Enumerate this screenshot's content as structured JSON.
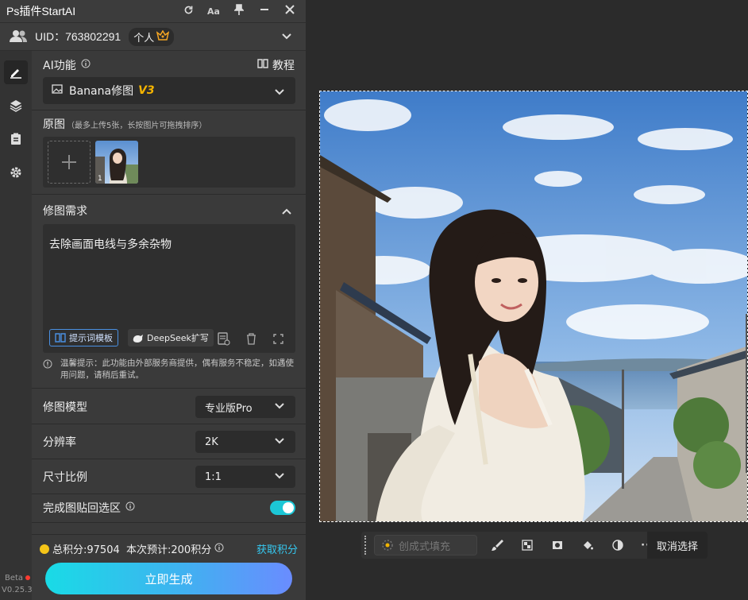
{
  "app": {
    "title": "Ps插件StartAI",
    "title_icons": [
      "refresh-icon",
      "font-size-icon",
      "pin-icon",
      "minimize-icon",
      "close-icon"
    ]
  },
  "user": {
    "uid_label": "UID：763802291",
    "plan_badge": "个人"
  },
  "sidebar": {
    "items": [
      "edit-icon",
      "layers-icon",
      "clipboard-icon",
      "gear-icon"
    ],
    "beta_label": "Beta",
    "version": "V0.25.3"
  },
  "ai_function": {
    "label": "AI功能",
    "tutorial_label": "教程",
    "selected_model": "Banana修图",
    "selected_version": "V3"
  },
  "source_images": {
    "label": "原图",
    "hint": "（最多上传5张，长按图片可拖拽排序）",
    "thumb_index": "1"
  },
  "requirement": {
    "label": "修图需求",
    "prompt_text": "去除画面电线与多余杂物",
    "template_button": "提示词模板",
    "deepseek_button": "DeepSeek扩写",
    "tip": "温馨提示：此功能由外部服务商提供，偶有服务不稳定，如遇使用问题，请稍后重试。"
  },
  "settings": {
    "model_label": "修图模型",
    "model_value": "专业版Pro",
    "resolution_label": "分辨率",
    "resolution_value": "2K",
    "ratio_label": "尺寸比例",
    "ratio_value": "1:1",
    "paste_back_label": "完成图贴回选区",
    "paste_back_on": true
  },
  "footer": {
    "credits_text": "总积分:97504  本次预计:200积分",
    "get_credits": "获取积分",
    "generate_button": "立即生成"
  },
  "photoshop_toolbar": {
    "generative_fill": "创成式填充",
    "deselect": "取消选择",
    "icons": [
      "brush-icon",
      "mask-icon",
      "layer-mask-icon",
      "fill-bucket-icon",
      "adjustment-icon",
      "more-icon"
    ]
  },
  "colors": {
    "accent_cyan": "#1cc7d6",
    "version_gold": "#f5b400",
    "link_blue": "#35c8f0"
  }
}
